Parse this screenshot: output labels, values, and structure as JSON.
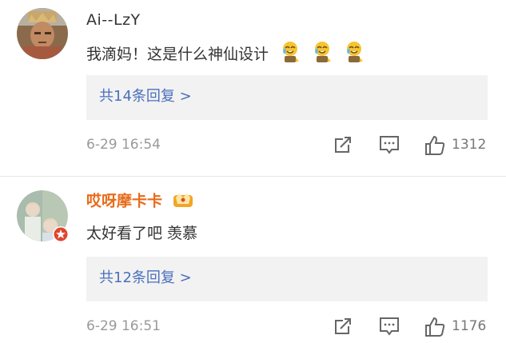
{
  "comments": [
    {
      "username": "Ai--LzY",
      "text": "我滴妈！这是什么神仙设计",
      "emojis": [
        "crying-laughing-emoji",
        "crying-laughing-emoji",
        "crying-laughing-emoji"
      ],
      "reply_link": "共14条回复 >",
      "time": "6-29 16:54",
      "likes": "1312"
    },
    {
      "username": "哎呀摩卡卡",
      "badge_icon": "vip-crown-icon",
      "text": "太好看了吧 羡慕",
      "reply_link": "共12条回复 >",
      "time": "6-29 16:51",
      "likes": "1176"
    }
  ],
  "colors": {
    "username_highlight": "#e86b1a",
    "reply_link": "#4a6fbd",
    "reply_box_bg": "#f2f2f2",
    "meta_text": "#999999",
    "verified_badge": "#e0452e"
  },
  "icons": {
    "share": "share-icon",
    "comment": "comment-icon",
    "like": "thumbs-up-icon"
  }
}
